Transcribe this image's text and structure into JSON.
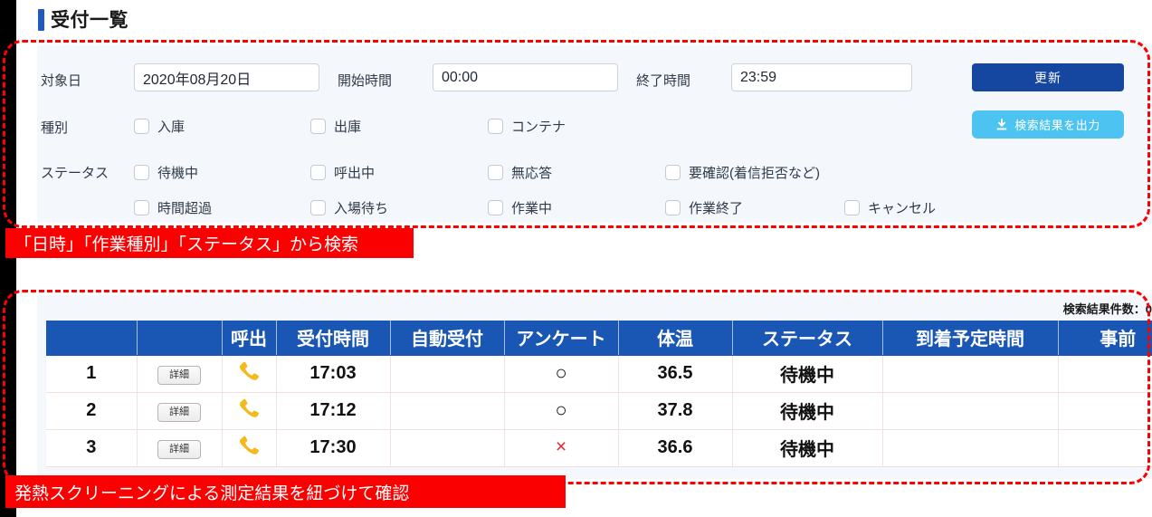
{
  "header": {
    "page_title": "受付一覧",
    "accent_color": "#1f5bbf"
  },
  "search_panel": {
    "date_label": "対象日",
    "date_value": "2020年08月20日",
    "start_label": "開始時間",
    "start_value": "00:00",
    "end_label": "終了時間",
    "end_value": "23:59",
    "update_button": "更新",
    "export_button": "検索結果を出力",
    "export_icon": "download-icon",
    "type_label": "種別",
    "type_options": [
      {
        "label": "入庫",
        "checked": false
      },
      {
        "label": "出庫",
        "checked": false
      },
      {
        "label": "コンテナ",
        "checked": false
      }
    ],
    "status_label": "ステータス",
    "status_options_row1": [
      {
        "label": "待機中",
        "checked": false
      },
      {
        "label": "呼出中",
        "checked": false
      },
      {
        "label": "無応答",
        "checked": false
      },
      {
        "label": "要確認(着信拒否など)",
        "checked": false
      }
    ],
    "status_options_row2": [
      {
        "label": "時間超過",
        "checked": false
      },
      {
        "label": "入場待ち",
        "checked": false
      },
      {
        "label": "作業中",
        "checked": false
      },
      {
        "label": "作業終了",
        "checked": false
      },
      {
        "label": "キャンセル",
        "checked": false
      }
    ]
  },
  "annotations": {
    "search_banner": "「日時」「作業種別」「ステータス」から検索",
    "table_banner": "発熱スクリーニングによる測定結果を紐づけて確認",
    "banner_color": "#fb0000"
  },
  "results": {
    "count_text": "検索結果件数：0",
    "columns": [
      "",
      "",
      "呼出",
      "受付時間",
      "自動受付",
      "アンケート",
      "体温",
      "ステータス",
      "到着予定時間",
      "事前"
    ],
    "header_bg": "#1a56b4",
    "rows": [
      {
        "no": "1",
        "detail_button": "詳細",
        "call_icon": "phone-icon",
        "reception_time": "17:03",
        "auto_reception": "",
        "questionnaire": "○",
        "questionnaire_mark": "o",
        "temperature": "36.5",
        "temp_high": false,
        "status": "待機中",
        "eta": "",
        "advance": ""
      },
      {
        "no": "2",
        "detail_button": "詳細",
        "call_icon": "phone-icon",
        "reception_time": "17:12",
        "auto_reception": "",
        "questionnaire": "○",
        "questionnaire_mark": "o",
        "temperature": "37.8",
        "temp_high": true,
        "status": "待機中",
        "eta": "",
        "advance": ""
      },
      {
        "no": "3",
        "detail_button": "詳細",
        "call_icon": "phone-icon",
        "reception_time": "17:30",
        "auto_reception": "",
        "questionnaire": "×",
        "questionnaire_mark": "x",
        "temperature": "36.6",
        "temp_high": false,
        "status": "待機中",
        "eta": "",
        "advance": ""
      }
    ]
  }
}
